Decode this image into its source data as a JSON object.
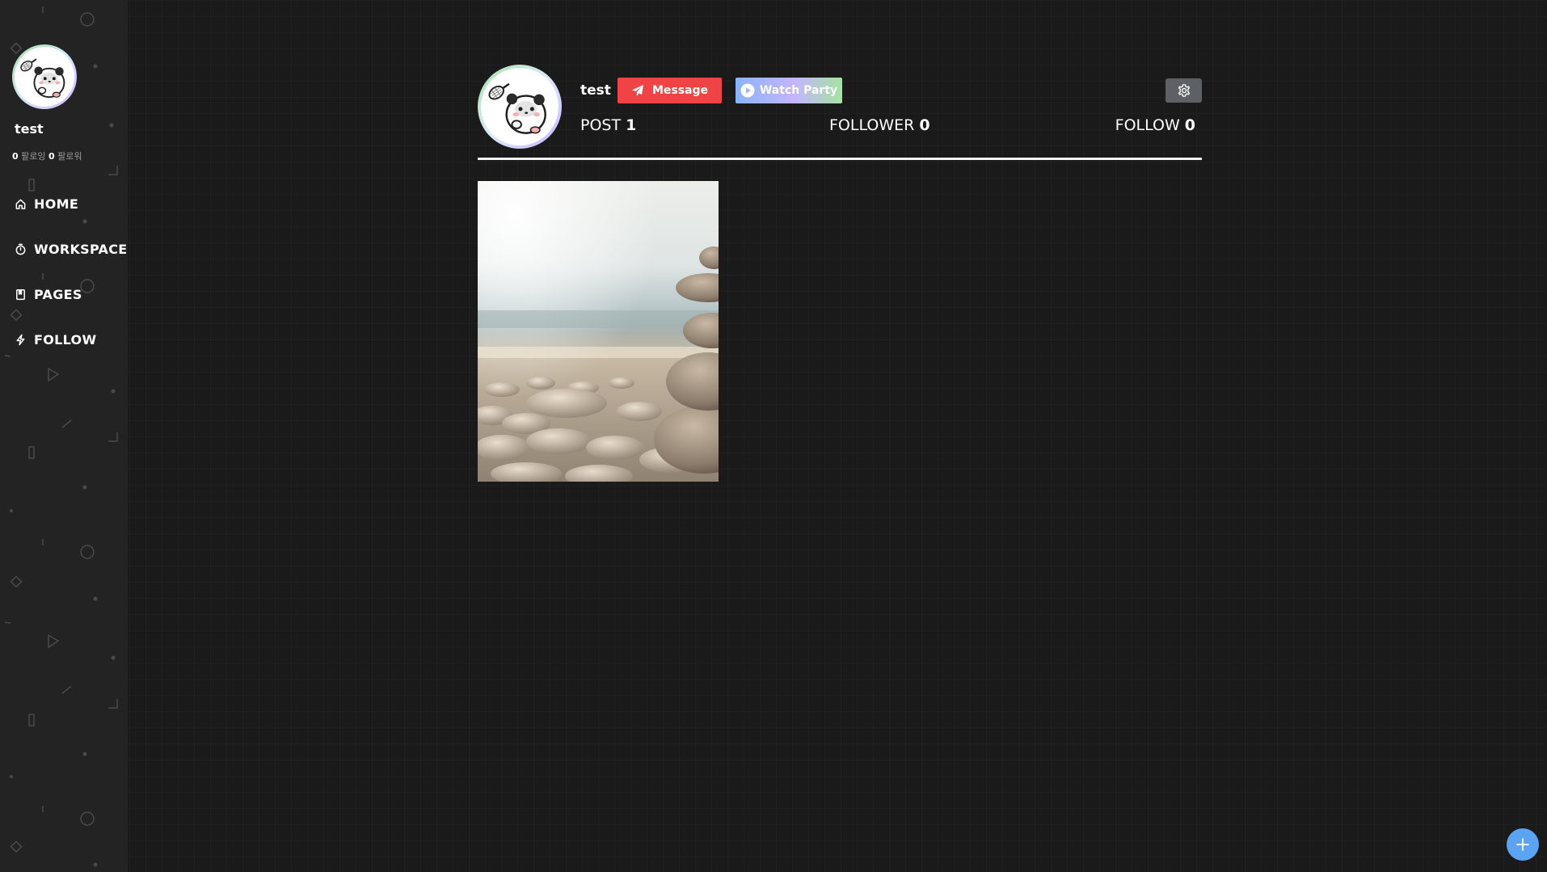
{
  "sidebar": {
    "username": "test",
    "following_count": "0",
    "following_label": "팔로잉",
    "follower_count": "0",
    "follower_label": "팔로워",
    "nav": [
      {
        "label": "HOME",
        "icon": "home-icon"
      },
      {
        "label": "WORKSPACE",
        "icon": "timer-icon"
      },
      {
        "label": "PAGES",
        "icon": "book-icon"
      },
      {
        "label": "FOLLOW",
        "icon": "bolt-icon"
      }
    ]
  },
  "profile": {
    "username": "test",
    "message_label": "Message",
    "watch_party_label": "Watch Party",
    "settings_icon": "gear-icon",
    "post_label": "POST",
    "post_count": "1",
    "follower_label": "FOLLOWER",
    "follower_count": "0",
    "follow_label": "FOLLOW",
    "follow_count": "0"
  },
  "posts": [
    {
      "image": "stacked-stones-beach-photo"
    }
  ],
  "fab": {
    "icon": "plus-icon"
  },
  "colors": {
    "background": "#1a1a1a",
    "sidebar": "#232323",
    "message_button": "#f04346",
    "settings_button": "#5d6166",
    "fab": "#5ba4f3"
  }
}
